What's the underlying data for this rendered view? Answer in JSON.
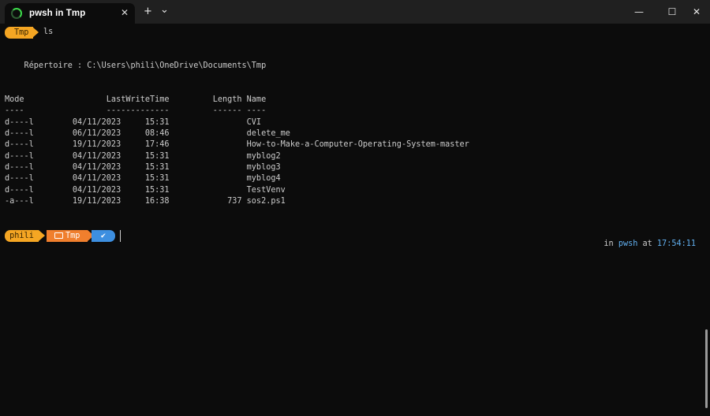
{
  "window": {
    "tab_title": "pwsh in Tmp",
    "tab_close": "✕",
    "new_tab": "+",
    "dropdown": "⌄",
    "minimize": "—",
    "maximize": "☐",
    "close": "✕"
  },
  "prompt1": {
    "dir": "Tmp",
    "command": "ls"
  },
  "listing": {
    "directory_line": "    Répertoire : C:\\Users\\phili\\OneDrive\\Documents\\Tmp",
    "header": "Mode                 LastWriteTime         Length Name",
    "underline": "----                 -------------         ------ ----",
    "rows": [
      "d----l        04/11/2023     15:31                CVI",
      "d----l        06/11/2023     08:46                delete_me",
      "d----l        19/11/2023     17:46                How-to-Make-a-Computer-Operating-System-master",
      "d----l        04/11/2023     15:31                myblog2",
      "d----l        04/11/2023     15:31                myblog3",
      "d----l        04/11/2023     15:31                myblog4",
      "d----l        04/11/2023     15:31                TestVenv",
      "-a---l        19/11/2023     16:38            737 sos2.ps1"
    ]
  },
  "prompt2": {
    "user": "phili",
    "dir": "Tmp",
    "status": "✔",
    "right_in": "in ",
    "right_shell": "pwsh",
    "right_at": " at ",
    "right_time": "17:54:11"
  },
  "colors": {
    "user_segment": "#f5a623",
    "dir_segment": "#f07f2d",
    "status_segment": "#3d8fe0",
    "accent_text": "#61afef"
  }
}
